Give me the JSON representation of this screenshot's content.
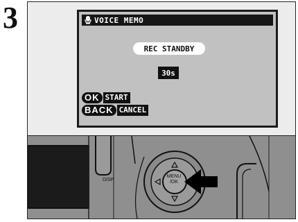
{
  "step": {
    "number": "3"
  },
  "lcd": {
    "title": "VOICE MEMO",
    "icon": "microphone-icon",
    "status": "REC STANDBY",
    "seconds": "30s",
    "actions": [
      {
        "key": "OK",
        "label": "START"
      },
      {
        "key": "BACK",
        "label": "CANCEL"
      }
    ]
  },
  "camera": {
    "disp_label": "DISP",
    "menu_label_top": "MENU",
    "menu_label_bottom": "/OK"
  },
  "colors": {
    "lcd_screen": "#c1c1c1",
    "camera_body": "#8f8f8f",
    "arrow": "#000000"
  }
}
